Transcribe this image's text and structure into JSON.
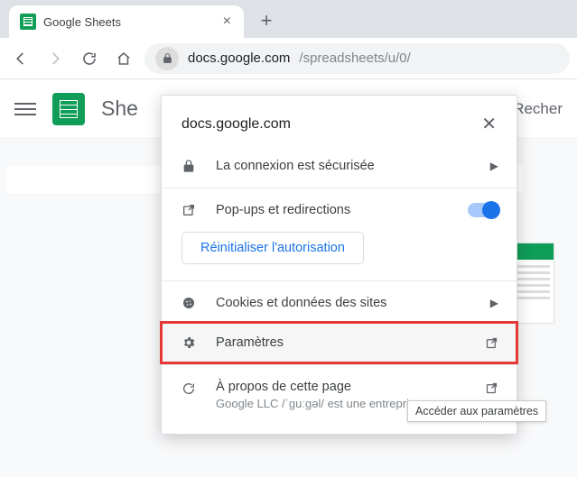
{
  "tab": {
    "title": "Google Sheets"
  },
  "url": {
    "host": "docs.google.com",
    "path": "/spreadsheets/u/0/"
  },
  "app": {
    "title_visible": "She",
    "search_hint_visible": "Recher"
  },
  "popup": {
    "host": "docs.google.com",
    "secure": "La connexion est sécurisée",
    "popups": "Pop-ups et redirections",
    "reset": "Réinitialiser l'autorisation",
    "cookies": "Cookies et données des sites",
    "settings": "Paramètres",
    "about": "À propos de cette page",
    "about_sub": "Google LLC /ˈɡuːɡəl/ est une entreprise…"
  },
  "tooltip": "Accéder aux paramètres"
}
